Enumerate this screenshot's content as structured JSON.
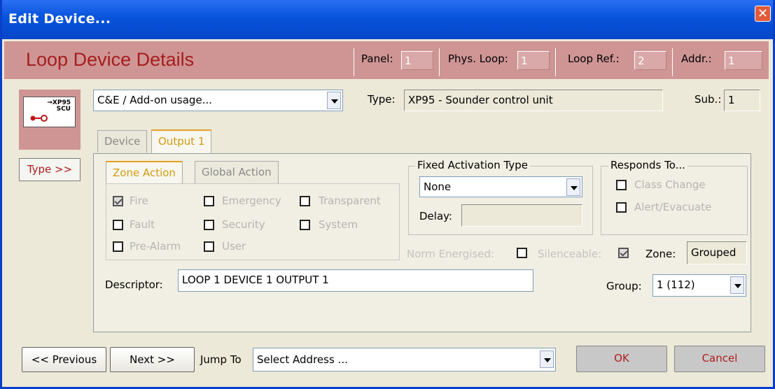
{
  "window": {
    "title": "Edit Device..."
  },
  "header": {
    "title": "Loop Device Details",
    "panel_label": "Panel:",
    "panel_value": "1",
    "phys_loop_label": "Phys. Loop:",
    "phys_loop_value": "1",
    "loop_ref_label": "Loop Ref.:",
    "loop_ref_value": "2",
    "addr_label": "Addr.:",
    "addr_value": "1"
  },
  "device": {
    "icon_text_line1": "→XP95",
    "icon_text_line2": "SCU",
    "type_button": "Type >>",
    "usage_value": "C&E / Add-on usage...",
    "type_label": "Type:",
    "type_value": "XP95 - Sounder control unit",
    "sub_label": "Sub.:",
    "sub_value": "1"
  },
  "tabs": {
    "device": "Device",
    "output1": "Output 1"
  },
  "action_tabs": {
    "zone": "Zone Action",
    "global": "Global Action"
  },
  "checkboxes": {
    "fire": "Fire",
    "emergency": "Emergency",
    "transparent": "Transparent",
    "fault": "Fault",
    "security": "Security",
    "system": "System",
    "pre_alarm": "Pre-Alarm",
    "user": "User"
  },
  "fixed_activation": {
    "label": "Fixed Activation Type",
    "value": "None",
    "delay_label": "Delay:",
    "delay_value": ""
  },
  "responds_to": {
    "label": "Responds To...",
    "class_change": "Class Change",
    "alert_evacuate": "Alert/Evacuate"
  },
  "options": {
    "norm_energised": "Norm Energised:",
    "silenceable": "Silenceable:",
    "zone_label": "Zone:",
    "zone_value": "Grouped"
  },
  "descriptor": {
    "label": "Descriptor:",
    "value": "LOOP 1 DEVICE 1 OUTPUT 1"
  },
  "group": {
    "label": "Group:",
    "value": "1 (112)"
  },
  "footer": {
    "previous": "<< Previous",
    "next": "Next >>",
    "jump_label": "Jump To",
    "jump_value": "Select Address ...",
    "ok": "OK",
    "cancel": "Cancel"
  }
}
